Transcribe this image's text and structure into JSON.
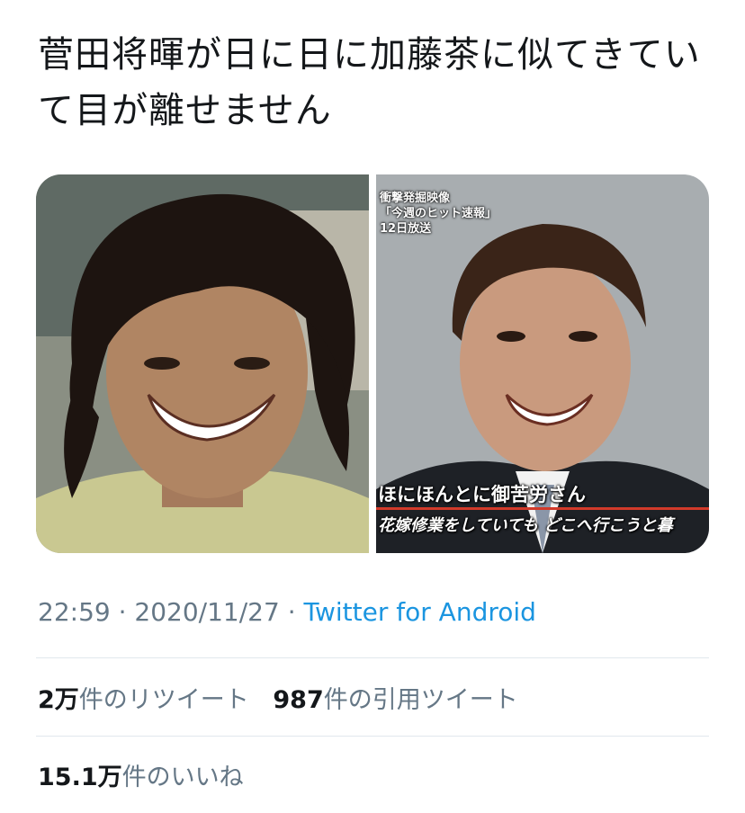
{
  "tweet": {
    "text": "菅田将暉が日に日に加藤茶に似てきていて目が離せません"
  },
  "media": {
    "tv_caption": {
      "line1": "衝撃発掘映像",
      "line2": "「今週のヒット速報」",
      "line3": "12日放送"
    },
    "subtitle1": "ほにほんとに御苦労さん",
    "subtitle2": "花嫁修業をしていても どこへ行こうと暮"
  },
  "meta": {
    "time": "22:59",
    "separator": "·",
    "date": "2020/11/27",
    "source": "Twitter for Android"
  },
  "stats": {
    "retweets_count": "2万",
    "retweets_label": "件のリツイート",
    "quotes_count": "987",
    "quotes_label": "件の引用ツイート",
    "likes_count": "15.1万",
    "likes_label": "件のいいね"
  },
  "colors": {
    "text": "#14171a",
    "secondary": "#657786",
    "link": "#1b95e0",
    "divider": "#e1e8ed"
  }
}
